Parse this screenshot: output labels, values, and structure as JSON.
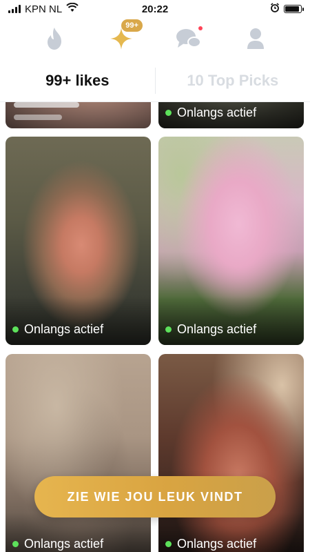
{
  "status_bar": {
    "carrier": "KPN NL",
    "time": "20:22",
    "icons": [
      "signal-icon",
      "wifi-icon",
      "alarm-icon",
      "battery-icon"
    ],
    "battery_level": 0.9
  },
  "nav": {
    "items": [
      "flame-icon",
      "sparkle-icon",
      "chat-bubbles-icon",
      "profile-icon"
    ],
    "active": "sparkle-icon",
    "likes_badge": "99+",
    "colors": {
      "active": "#e5b84f",
      "inactive": "#c7cdd6",
      "badge": "#d9a84a",
      "notification_dot": "#ff4458"
    }
  },
  "tabs": [
    {
      "label": "99+ likes",
      "active": true
    },
    {
      "label": "10 Top Picks",
      "active": false
    }
  ],
  "cards": [
    {
      "status": "Onlangs actief"
    },
    {
      "status": "Onlangs actief"
    },
    {
      "status": "Onlangs actief"
    },
    {
      "status": "Onlangs actief"
    },
    {
      "status": "Onlangs actief"
    }
  ],
  "cta": {
    "label": "ZIE WIE JOU LEUK VINDT"
  },
  "colors": {
    "online_dot": "#5de15b",
    "cta": "#e0ad48"
  }
}
